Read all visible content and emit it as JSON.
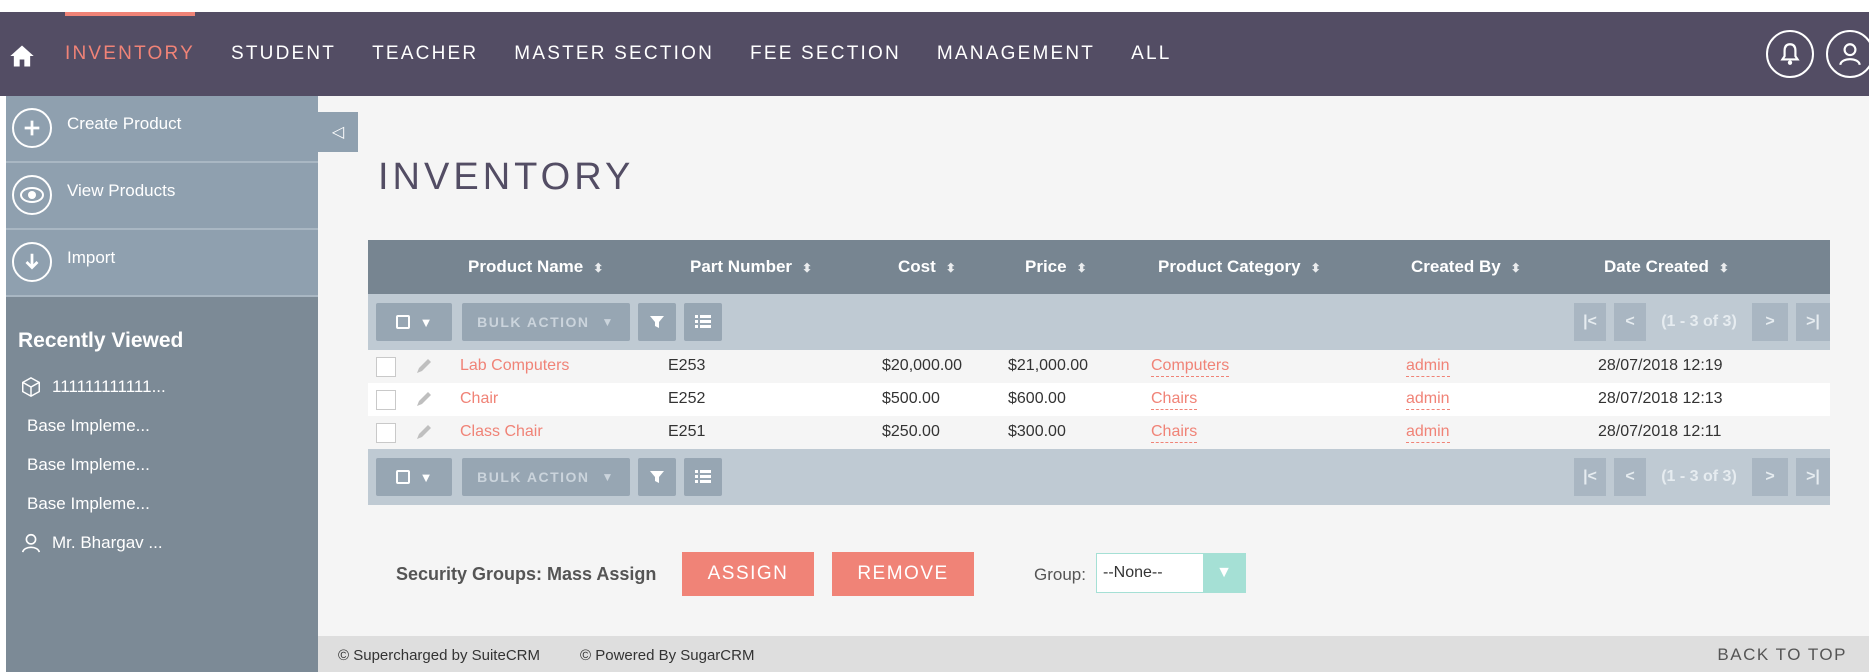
{
  "nav": {
    "items": [
      "INVENTORY",
      "STUDENT",
      "TEACHER",
      "MASTER SECTION",
      "FEE SECTION",
      "MANAGEMENT",
      "ALL"
    ],
    "active_index": 0,
    "accent_color": "#f08377",
    "bg_color": "#534d64"
  },
  "sidebar": {
    "actions": [
      {
        "label": "Create Product",
        "icon": "plus-icon"
      },
      {
        "label": "View Products",
        "icon": "eye-icon"
      },
      {
        "label": "Import",
        "icon": "download-icon"
      }
    ],
    "recent_title": "Recently Viewed",
    "recent_items": [
      {
        "label": "111111111111...",
        "icon": "box-icon"
      },
      {
        "label": "Base Impleme...",
        "icon": ""
      },
      {
        "label": "Base Impleme...",
        "icon": ""
      },
      {
        "label": "Base Impleme...",
        "icon": ""
      },
      {
        "label": "Mr. Bhargav ...",
        "icon": "user-icon"
      }
    ]
  },
  "main": {
    "collapse_glyph": "◁",
    "title": "INVENTORY"
  },
  "table": {
    "columns": [
      "Product Name",
      "Part Number",
      "Cost",
      "Price",
      "Product Category",
      "Created By",
      "Date Created"
    ],
    "sort_glyph": "⬍",
    "bulk_action": "BULK ACTION",
    "pagination": {
      "first": "|<",
      "prev": "<",
      "range": "(1 - 3 of 3)",
      "next": ">",
      "last": ">|"
    },
    "rows": [
      {
        "name": "Lab Computers",
        "part": "E253",
        "cost": "$20,000.00",
        "price": "$21,000.00",
        "category": "Computers",
        "created_by": "admin",
        "date": "28/07/2018 12:19"
      },
      {
        "name": "Chair",
        "part": "E252",
        "cost": "$500.00",
        "price": "$600.00",
        "category": "Chairs",
        "created_by": "admin",
        "date": "28/07/2018 12:13"
      },
      {
        "name": "Class Chair",
        "part": "E251",
        "cost": "$250.00",
        "price": "$300.00",
        "category": "Chairs",
        "created_by": "admin",
        "date": "28/07/2018 12:11"
      }
    ]
  },
  "mass_assign": {
    "label": "Security Groups: Mass Assign",
    "assign": "ASSIGN",
    "remove": "REMOVE",
    "group_label": "Group:",
    "group_value": "--None--"
  },
  "footer": {
    "supercharged": "© Supercharged by SuiteCRM",
    "powered": "© Powered By SugarCRM",
    "back_to_top": "BACK TO TOP"
  }
}
